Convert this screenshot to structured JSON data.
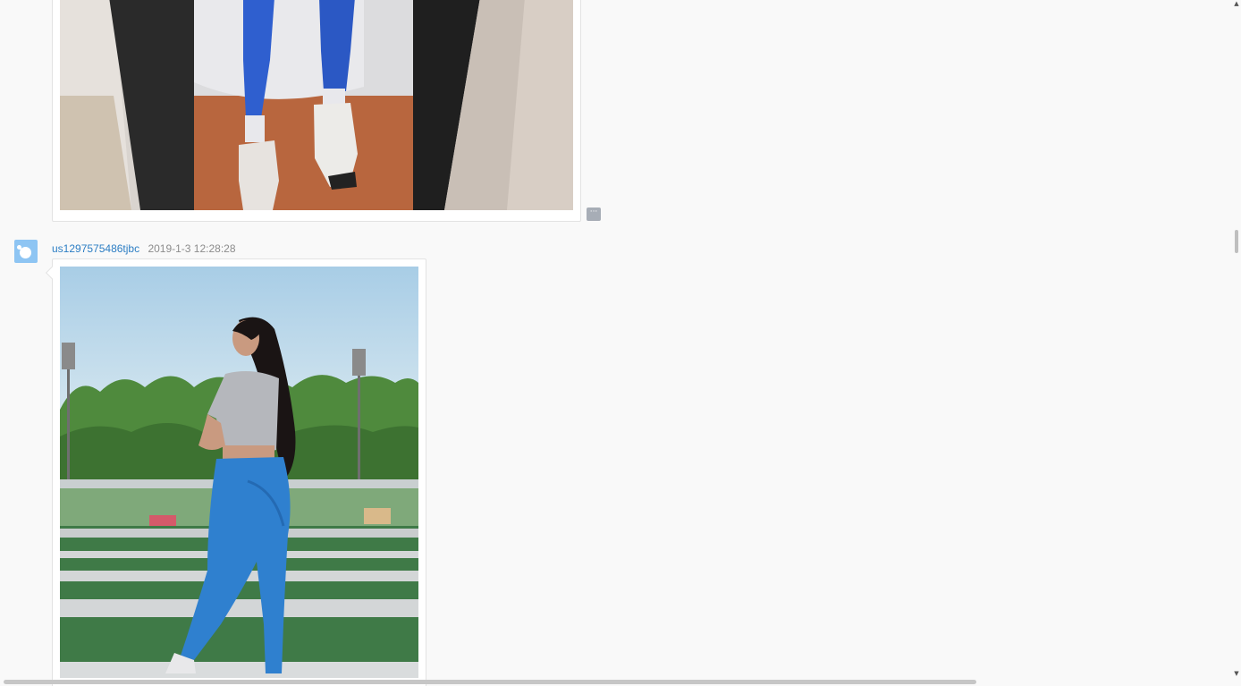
{
  "messages": [
    {
      "type": "image",
      "image_alt": "mirror selfie photo"
    },
    {
      "type": "image",
      "username": "us1297575486tjbc",
      "timestamp": "2019-1-3 12:28:28",
      "image_alt": "photo"
    }
  ],
  "more_button": {
    "icon": "more-icon",
    "label": "···"
  },
  "scrollbar": {
    "up_arrow": "▲",
    "down_arrow": "▼"
  },
  "colors": {
    "username": "#2d7ec4",
    "timestamp": "#8c8c8c",
    "avatar": "#8ec5f3",
    "background": "#f9f9f9"
  }
}
